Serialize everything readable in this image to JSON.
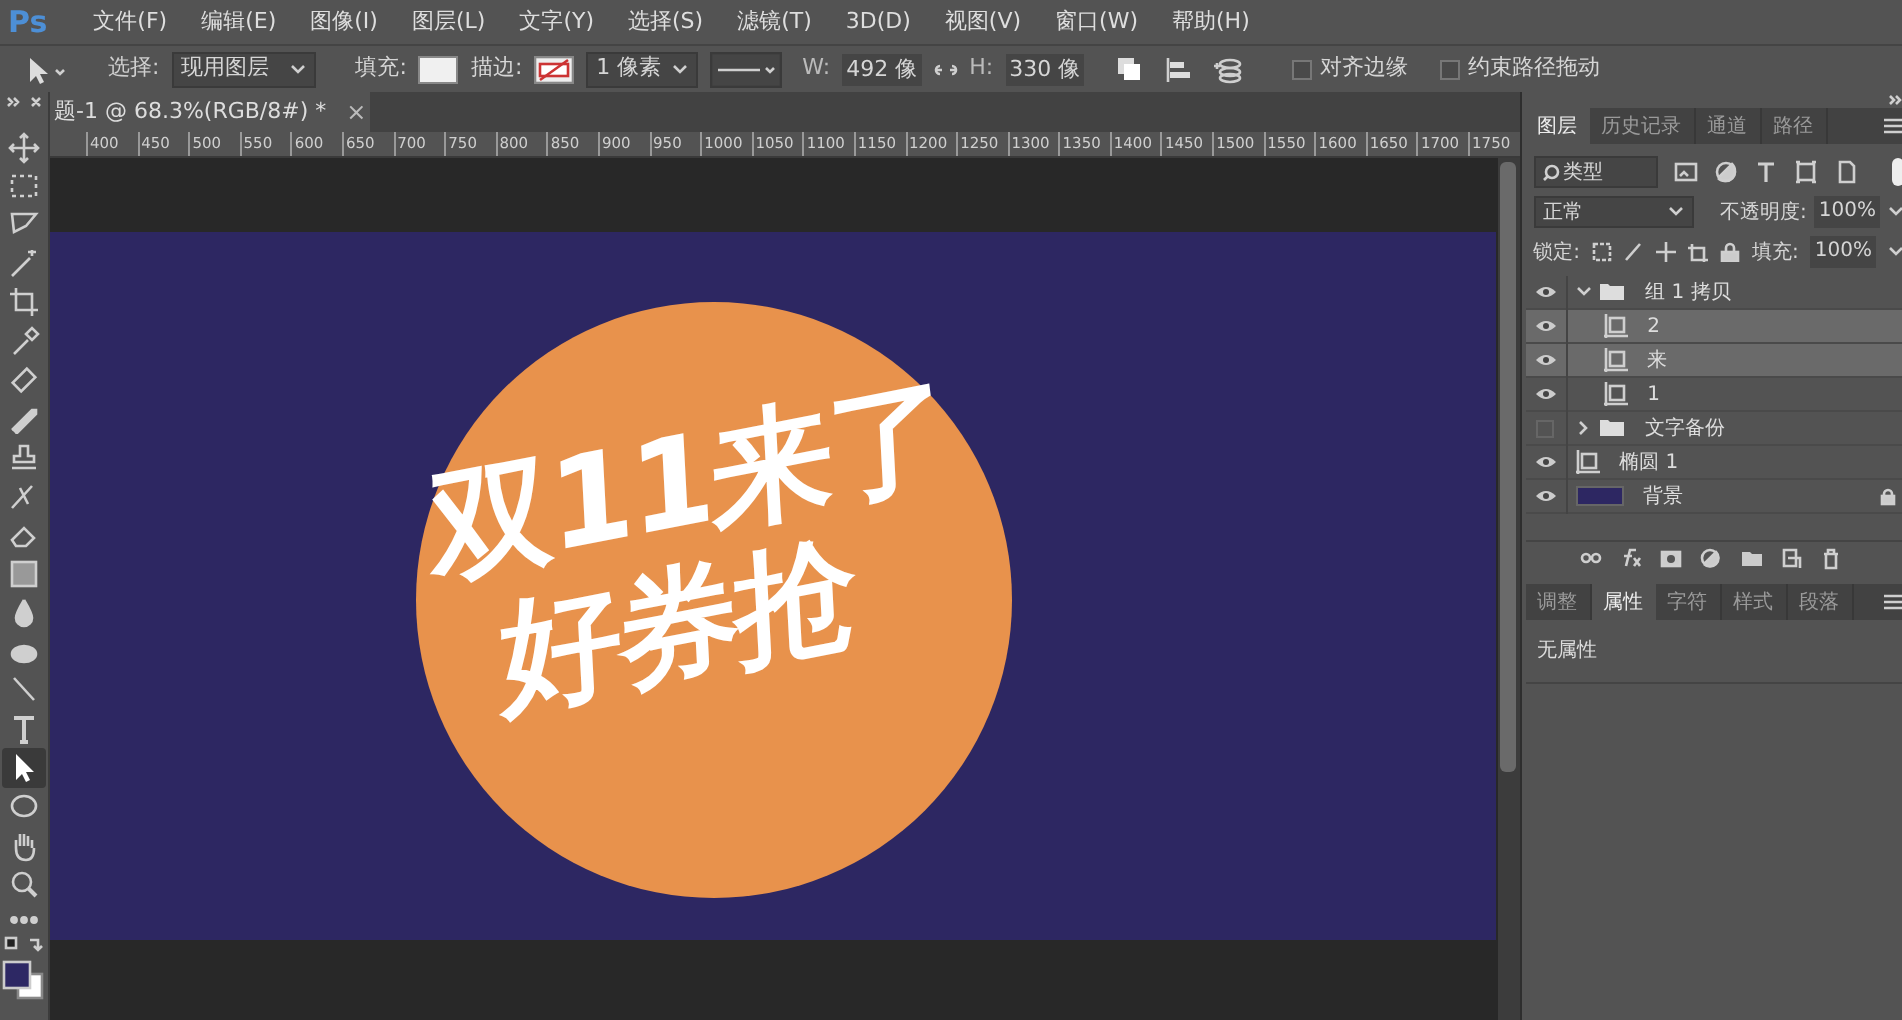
{
  "app": {
    "logo": "Ps",
    "menu": [
      "文件(F)",
      "编辑(E)",
      "图像(I)",
      "图层(L)",
      "文字(Y)",
      "选择(S)",
      "滤镜(T)",
      "3D(D)",
      "视图(V)",
      "窗口(W)",
      "帮助(H)"
    ]
  },
  "options_bar": {
    "select_label": "选择:",
    "select_value": "现用图层",
    "fill_label": "填充:",
    "stroke_label": "描边:",
    "stroke_width": "1 像素",
    "w_label": "W:",
    "w_value": "492 像",
    "h_label": "H:",
    "h_value": "330 像",
    "checkboxes": [
      {
        "label": "对齐边缘",
        "checked": false
      },
      {
        "label": "约束路径拖动",
        "checked": false
      }
    ]
  },
  "document_tab": {
    "title": "题-1 @ 68.3%(RGB/8#) *",
    "close": "×"
  },
  "ruler": [
    "400",
    "450",
    "500",
    "550",
    "600",
    "650",
    "700",
    "750",
    "800",
    "850",
    "900",
    "950",
    "1000",
    "1050",
    "1100",
    "1150",
    "1200",
    "1250",
    "1300",
    "1350",
    "1400",
    "1450",
    "1500",
    "1550",
    "1600",
    "1650",
    "1700",
    "1750"
  ],
  "artwork": {
    "line_1": "双11来了",
    "line_2": "好券抢"
  },
  "tools": [
    {
      "selected": false
    },
    {
      "selected": false
    },
    {
      "selected": false
    },
    {
      "selected": false
    },
    {
      "selected": false
    },
    {
      "selected": false
    },
    {
      "selected": false
    },
    {
      "selected": false
    },
    {
      "selected": false
    },
    {
      "selected": false
    },
    {
      "selected": false
    },
    {
      "selected": false
    },
    {
      "selected": false
    },
    {
      "selected": false
    },
    {
      "selected": false
    },
    {
      "selected": false
    },
    {
      "selected": true
    },
    {
      "selected": false
    },
    {
      "selected": false
    },
    {
      "selected": false
    }
  ],
  "layers_panel": {
    "tabs": [
      {
        "label": "图层",
        "selected": true
      },
      {
        "label": "历史记录",
        "selected": false
      },
      {
        "label": "通道",
        "selected": false
      },
      {
        "label": "路径",
        "selected": false
      }
    ],
    "filter": "类型",
    "blend_mode": "正常",
    "opacity_label": "不透明度:",
    "opacity": "100%",
    "lock_label": "锁定:",
    "fill_label": "填充:",
    "fill": "100%",
    "layers": [
      {
        "name": "组 1 拷贝",
        "kind": "group",
        "visible": true,
        "selected": false,
        "expanded": true,
        "children": [
          {
            "name": "2",
            "kind": "shape",
            "visible": true,
            "selected": true
          },
          {
            "name": "来",
            "kind": "shape",
            "visible": true,
            "selected": true
          },
          {
            "name": "1",
            "kind": "shape",
            "visible": true,
            "selected": false
          }
        ]
      },
      {
        "name": "文字备份",
        "kind": "group",
        "visible": false,
        "selected": false,
        "expanded": false
      },
      {
        "name": "椭圆 1",
        "kind": "shape",
        "visible": true,
        "selected": false
      },
      {
        "name": "背景",
        "kind": "fill",
        "visible": true,
        "selected": false,
        "locked": true
      }
    ]
  },
  "properties_panel": {
    "tabs": [
      {
        "label": "调整",
        "selected": false
      },
      {
        "label": "属性",
        "selected": true
      },
      {
        "label": "字符",
        "selected": false
      },
      {
        "label": "样式",
        "selected": false
      },
      {
        "label": "段落",
        "selected": false
      }
    ],
    "message": "无属性"
  }
}
